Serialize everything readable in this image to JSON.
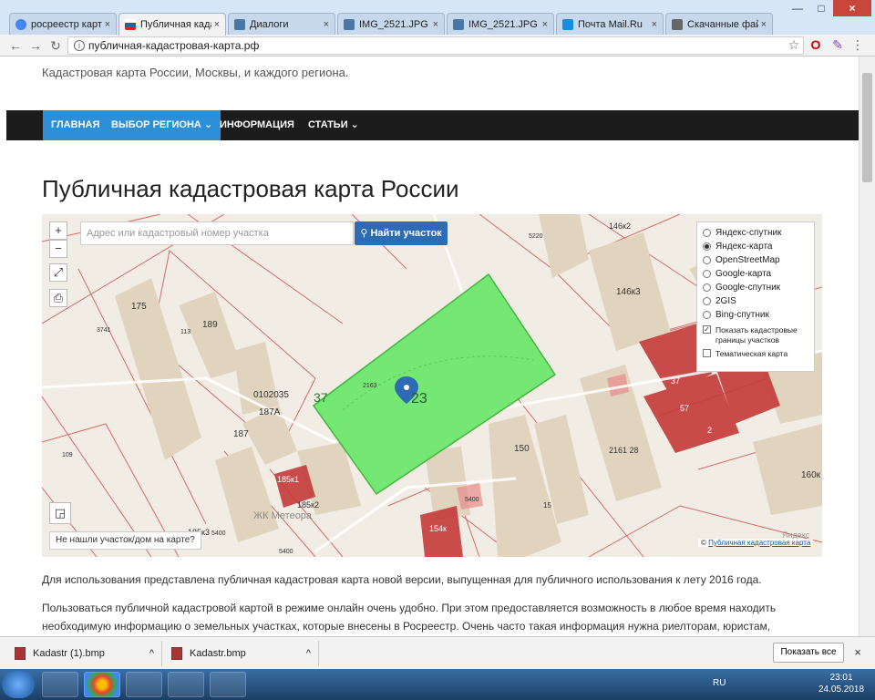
{
  "browser": {
    "tabs": [
      {
        "title": "росреестр карты",
        "color": "#4285f4"
      },
      {
        "title": "Публичная кадаст",
        "color": "#d52b1e",
        "active": true
      },
      {
        "title": "Диалоги",
        "color": "#4a76a8"
      },
      {
        "title": "IMG_2521.JPG",
        "color": "#4a76a8"
      },
      {
        "title": "IMG_2521.JPG",
        "color": "#4a76a8"
      },
      {
        "title": "Почта Mail.Ru",
        "color": "#168de2"
      },
      {
        "title": "Скачанные файлы",
        "color": "#666666"
      }
    ],
    "tab_close": "×",
    "url": "публичная-кадастровая-карта.рф",
    "win_min": "—",
    "win_max": "□",
    "win_close": "×"
  },
  "site": {
    "subtitle": "Кадастровая карта России, Москвы, и каждого региона.",
    "nav": [
      "ГЛАВНАЯ",
      "ВЫБОР РЕГИОНА ⌄",
      "ИНФОРМАЦИЯ",
      "СТАТЬИ ⌄"
    ],
    "heading": "Публичная кадастровая карта России"
  },
  "map": {
    "search_placeholder": "Адрес или кадастровый номер участка",
    "search_button": "Найти участок",
    "zoom_in": "+",
    "zoom_out": "−",
    "layers": [
      "Яндекс-спутник",
      "Яндекс-карта",
      "OpenStreetMap",
      "Google-карта",
      "Google-спутник",
      "2GIS",
      "Bing-спутник"
    ],
    "selected_layer": "Яндекс-карта",
    "show_borders_label": "Показать кадастровые границы участков",
    "show_borders_checked": true,
    "thematic_label": "Тематическая карта",
    "thematic_checked": false,
    "not_found": "Не нашли участок/дом на карте?",
    "credit_prefix": "©",
    "credit": "Публичная кадастровая карта",
    "labels": {
      "n175": "175",
      "n189": "189",
      "n113": "113",
      "n3741": "3741",
      "n5220": "5220",
      "n146k2": "146к2",
      "n146k3": "146к3",
      "n0102035": "0102035",
      "n187a": "187А",
      "n187": "187",
      "n109": "109",
      "n37": "37",
      "n2163": "2163",
      "n23": "23",
      "n150": "150",
      "n15": "15",
      "n2161": "2161 28",
      "n160k": "160к",
      "n185k1": "185к1",
      "n185k2": "185к2",
      "n185k3": "185к3",
      "n5400a": "5400",
      "n5400b": "5400",
      "n5400c": "5400",
      "meteora": "ЖК Метеора",
      "n154k": "154к",
      "n37b": "37",
      "n57": "57",
      "n2": "2",
      "yandex": "Яндекс"
    }
  },
  "text": {
    "p1": "Для использования представлена публичная кадастровая карта новой версии, выпущенная для публичного использования к лету 2016 года.",
    "p2": "Пользоваться публичной кадастровой картой в режиме онлайн очень удобно. При этом предоставляется возможность в любое время находить необходимую информацию о земельных участках, которые внесены в Росреестр. Очень часто такая информация нужна риелторам, юристам,"
  },
  "downloads": {
    "items": [
      {
        "name": "Kadastr (1).bmp"
      },
      {
        "name": "Kadastr.bmp"
      }
    ],
    "chevron": "^",
    "show_all": "Показать все",
    "close": "×"
  },
  "taskbar": {
    "lang": "RU",
    "time": "23:01",
    "date": "24.05.2018"
  },
  "colors": {
    "parcel_green": "#6ee86e",
    "parcel_red": "#c43a3a",
    "nav_bg": "#1c1c1c",
    "nav_active": "#2d8fd5",
    "button_blue": "#2d6cb5"
  }
}
